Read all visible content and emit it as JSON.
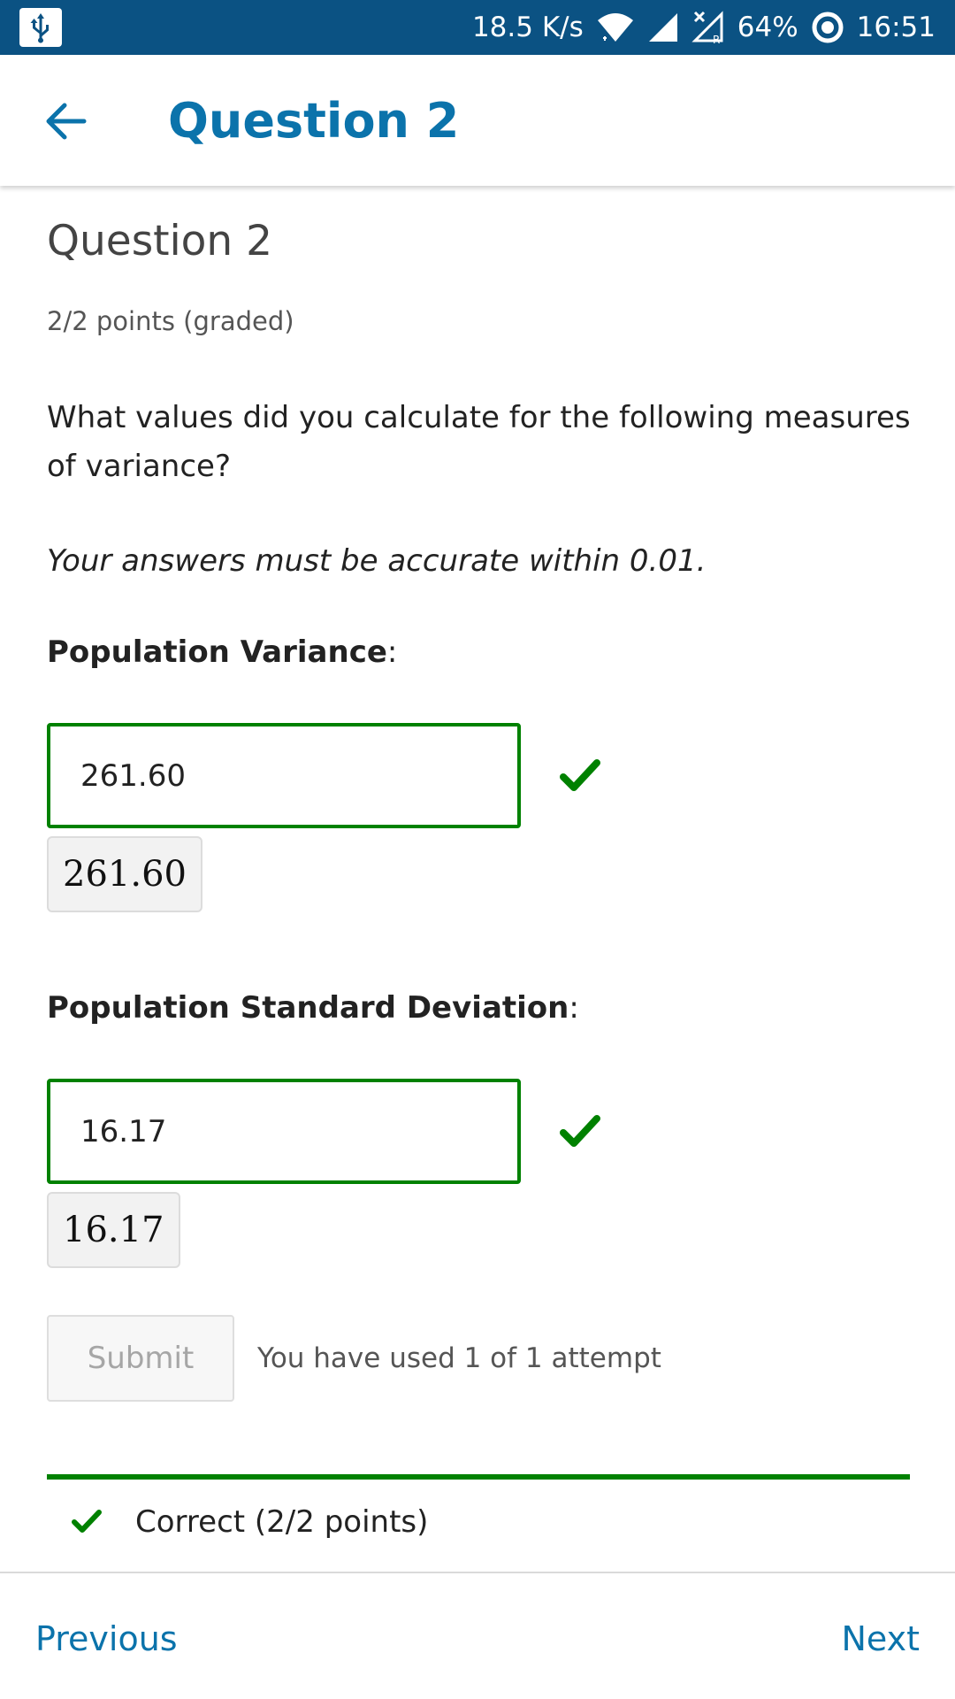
{
  "status_bar": {
    "network_speed": "18.5 K/s",
    "battery": "64%",
    "time": "16:51",
    "icons": [
      "usb-icon",
      "wifi-icon",
      "signal-icon",
      "no-signal-roaming-icon",
      "sync-icon"
    ]
  },
  "app_bar": {
    "back_icon": "arrow-back-icon",
    "title": "Question 2"
  },
  "problem": {
    "title": "Question 2",
    "points": "2/2 points (graded)",
    "prompt": "What values did you calculate for the following measures of variance?",
    "accuracy_note": "Your answers must be accurate within 0.01."
  },
  "fields": [
    {
      "label": "Population Variance",
      "suffix": ":",
      "value": "261.60",
      "preview": "261.60",
      "status": "correct"
    },
    {
      "label": "Population Standard Deviation",
      "suffix": ":",
      "value": "16.17",
      "preview": "16.17",
      "status": "correct"
    }
  ],
  "actions": {
    "submit_label": "Submit",
    "attempts_text": "You have used 1 of 1 attempt"
  },
  "feedback": {
    "text": "Correct (2/2 points)"
  },
  "navigation": {
    "previous_label": "Previous",
    "next_label": "Next"
  },
  "colors": {
    "status_bar": "#0b5283",
    "accent": "#0b73ab",
    "correct": "#008100"
  }
}
